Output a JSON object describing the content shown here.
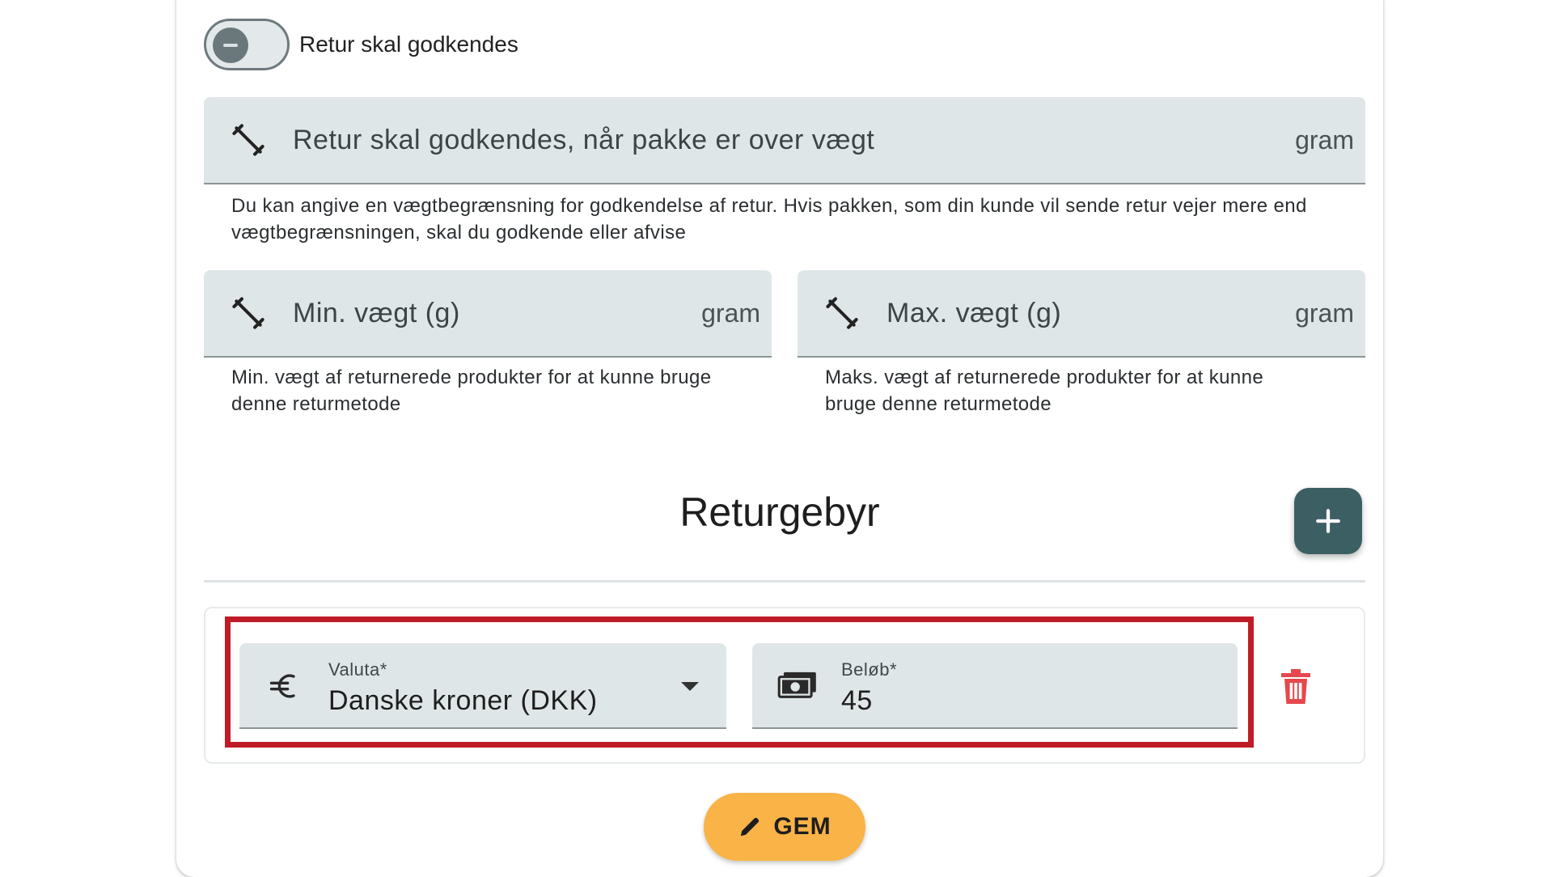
{
  "toggle": {
    "label": "Retur skal godkendes",
    "state": "off"
  },
  "approval_weight": {
    "placeholder": "Retur skal godkendes, når pakke er over vægt",
    "suffix": "gram",
    "hint": "Du kan angive en vægtbegrænsning for godkendelse af retur. Hvis pakken, som din kunde vil sende retur vejer mere end vægtbegrænsningen, skal du godkende eller afvise",
    "icon": "weight-icon"
  },
  "min_weight": {
    "placeholder": "Min. vægt (g)",
    "suffix": "gram",
    "hint": "Min. vægt af returnerede produkter for at kunne bruge denne returmetode",
    "icon": "weight-icon"
  },
  "max_weight": {
    "placeholder": "Max. vægt (g)",
    "suffix": "gram",
    "hint": "Maks. vægt af returnerede produkter for at kunne bruge denne returmetode",
    "icon": "weight-icon"
  },
  "return_fee": {
    "title": "Returgebyr",
    "add_icon": "plus-icon",
    "currency": {
      "label": "Valuta*",
      "value": "Danske kroner (DKK)",
      "icon": "euro-icon"
    },
    "amount": {
      "label": "Beløb*",
      "value": "45",
      "icon": "money-icon"
    },
    "delete_icon": "trash-icon"
  },
  "save_button": {
    "label": "GEM",
    "icon": "pencil-icon"
  },
  "colors": {
    "field_bg": "#dfe6e7",
    "fab": "#3c5f63",
    "save": "#f9b347",
    "highlight": "#c01c28",
    "delete": "#e5484d"
  }
}
